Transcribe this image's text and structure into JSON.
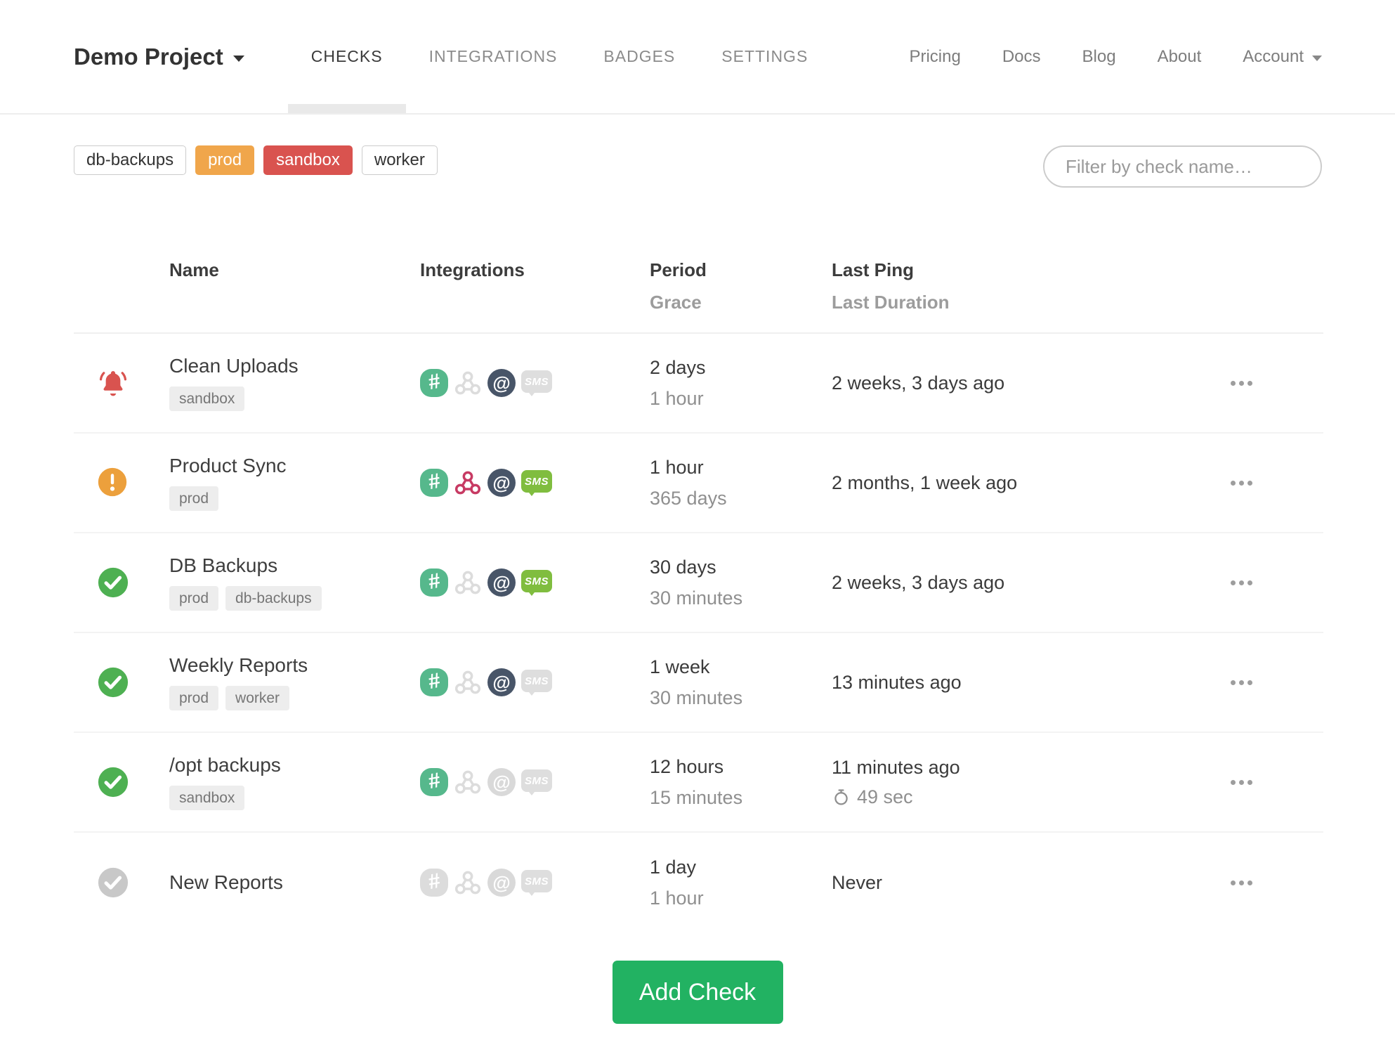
{
  "brand": {
    "project_name": "Demo Project"
  },
  "nav": {
    "tabs": [
      {
        "label": "CHECKS",
        "active": true
      },
      {
        "label": "INTEGRATIONS",
        "active": false
      },
      {
        "label": "BADGES",
        "active": false
      },
      {
        "label": "SETTINGS",
        "active": false
      }
    ],
    "links": [
      "Pricing",
      "Docs",
      "Blog",
      "About"
    ],
    "account_label": "Account"
  },
  "filters": {
    "tags": [
      {
        "label": "db-backups",
        "style": "outline"
      },
      {
        "label": "prod",
        "style": "warning"
      },
      {
        "label": "sandbox",
        "style": "danger"
      },
      {
        "label": "worker",
        "style": "outline"
      }
    ],
    "search_placeholder": "Filter by check name…"
  },
  "table": {
    "headers": {
      "name": "Name",
      "integrations": "Integrations",
      "period": "Period",
      "grace": "Grace",
      "last_ping": "Last Ping",
      "last_duration": "Last Duration"
    }
  },
  "checks": [
    {
      "name": "Clean Uploads",
      "status": "alert",
      "tags": [
        "sandbox"
      ],
      "integrations": {
        "slack": true,
        "webhook": false,
        "email": true,
        "sms": false
      },
      "period": "2 days",
      "grace": "1 hour",
      "last_ping": "2 weeks, 3 days ago",
      "last_duration": null
    },
    {
      "name": "Product Sync",
      "status": "warning",
      "tags": [
        "prod"
      ],
      "integrations": {
        "slack": true,
        "webhook": true,
        "email": true,
        "sms": true
      },
      "period": "1 hour",
      "grace": "365 days",
      "last_ping": "2 months, 1 week ago",
      "last_duration": null
    },
    {
      "name": "DB Backups",
      "status": "ok",
      "tags": [
        "prod",
        "db-backups"
      ],
      "integrations": {
        "slack": true,
        "webhook": false,
        "email": true,
        "sms": true
      },
      "period": "30 days",
      "grace": "30 minutes",
      "last_ping": "2 weeks, 3 days ago",
      "last_duration": null
    },
    {
      "name": "Weekly Reports",
      "status": "ok",
      "tags": [
        "prod",
        "worker"
      ],
      "integrations": {
        "slack": true,
        "webhook": false,
        "email": true,
        "sms": false
      },
      "period": "1 week",
      "grace": "30 minutes",
      "last_ping": "13 minutes ago",
      "last_duration": null
    },
    {
      "name": "/opt backups",
      "status": "ok",
      "tags": [
        "sandbox"
      ],
      "integrations": {
        "slack": true,
        "webhook": false,
        "email": false,
        "sms": false
      },
      "period": "12 hours",
      "grace": "15 minutes",
      "last_ping": "11 minutes ago",
      "last_duration": "49 sec"
    },
    {
      "name": "New Reports",
      "status": "new",
      "tags": [],
      "integrations": {
        "slack": false,
        "webhook": false,
        "email": false,
        "sms": false
      },
      "period": "1 day",
      "grace": "1 hour",
      "last_ping": "Never",
      "last_duration": null
    }
  ],
  "actions": {
    "add_check_label": "Add Check"
  },
  "colors": {
    "status_alert": "#d9534f",
    "status_warning": "#eca03c",
    "status_ok": "#4eb052",
    "status_new": "#c8c8c8",
    "slack": "#56b88c",
    "webhook": "#c73a63",
    "email": "#485568",
    "sms": "#80bd3f",
    "tag_warning": "#f0a64b",
    "tag_danger": "#d9534f",
    "add_button": "#22b262"
  }
}
